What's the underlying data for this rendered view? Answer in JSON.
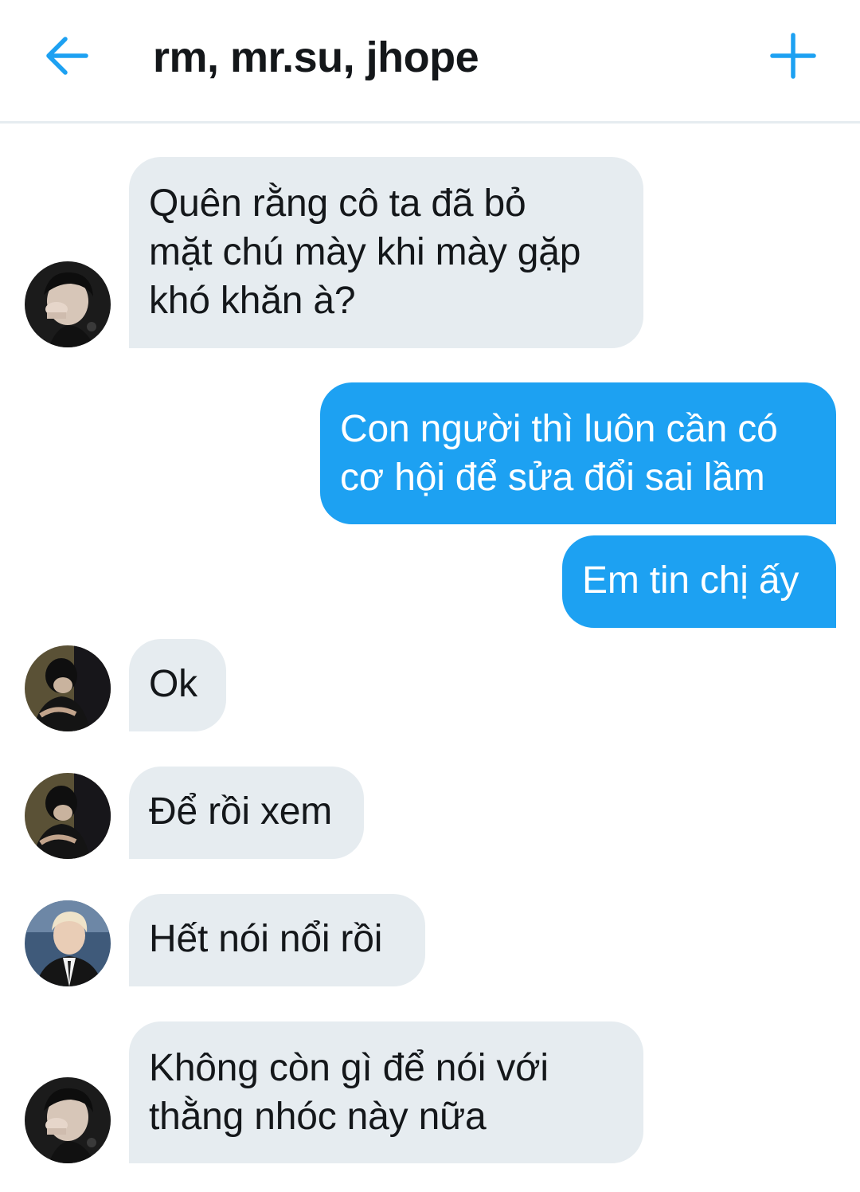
{
  "header": {
    "title": "rm, mr.su, jhope",
    "back_icon": "arrow-left-icon",
    "add_icon": "plus-icon"
  },
  "colors": {
    "accent": "#1da1f2",
    "incoming_bubble": "#e6ecf0",
    "text_dark": "#14171a",
    "divider": "#e6ecf0"
  },
  "messages": [
    {
      "direction": "incoming",
      "text": "Quên rằng cô ta đã bỏ\nmặt chú mày khi mày gặp\nkhó khăn à?",
      "avatar": "avatar-hand-over-face"
    },
    {
      "direction": "outgoing",
      "text": "Con người thì luôn cần có\ncơ hội để sửa đổi sai lầm"
    },
    {
      "direction": "outgoing",
      "text": "Em tin chị ấy"
    },
    {
      "direction": "incoming",
      "text": "Ok",
      "avatar": "avatar-dark-seated"
    },
    {
      "direction": "incoming",
      "text": "Để rồi xem",
      "avatar": "avatar-dark-seated"
    },
    {
      "direction": "incoming",
      "text": "Hết nói nổi rồi",
      "avatar": "avatar-suit-blond"
    },
    {
      "direction": "incoming",
      "text": "Không còn gì để nói với\nthằng nhóc này nữa",
      "avatar": "avatar-hand-over-face"
    }
  ]
}
